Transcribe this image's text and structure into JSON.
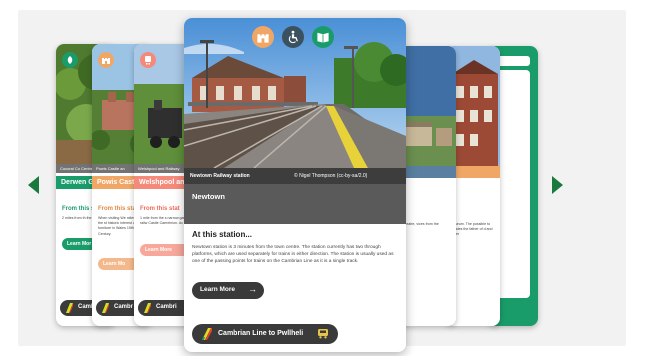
{
  "carousel": {
    "prev_label": "",
    "next_label": ""
  },
  "main_card": {
    "photo_caption": "Newtown Railway station",
    "photo_credit": "© Nigel Thompson (cc-by-sa/2.0)",
    "town": "Newtown",
    "section_title": "At this station...",
    "description": "Newtown station is 3 minutes from the town centre. The station currently has two through platforms, which are used separately for trains in either direction. The station is usually used as one of the passing points for trains on the Cambrian Line as it is a single track.",
    "learn_more": "Learn More",
    "line_button": "Cambrian Line to Pwllheli",
    "icons": [
      "castle-icon",
      "accessibility-icon",
      "book-icon"
    ],
    "colors": {
      "castle": "#f0a766",
      "access": "#3c5160",
      "book": "#1a9c6a",
      "band": "#5a5a5a"
    }
  },
  "left_cards": [
    {
      "title": "Derwen Ga",
      "caption": "Cocoral Co Centre",
      "sub": "From this st",
      "body": "2 miles from th the themed ga",
      "learn": "Learn Mor",
      "line": "Camb",
      "color": "#1a9c6a",
      "badge_text": "V",
      "icon": "leaf-icon"
    },
    {
      "title": "Powis Castl",
      "caption": "Powis Castle an",
      "sub": "From this stat",
      "body": "When visiting We miles from the st historic interest a furniture in Wales 19th Century.",
      "learn": "Learn Mo",
      "line": "Cambr",
      "color": "#f0a766",
      "badge_text": "W",
      "icon": "castle-icon"
    },
    {
      "title": "Welshpool an",
      "caption": "Welshpool and Railway",
      "sub": "From this stat",
      "body": "1 mile from the s narrow gauge railw Castle Caereinion. Ac",
      "learn": "Learn More",
      "line": "Cambri",
      "color": "#f58a7a",
      "badge_text": "Railw",
      "icon": "train-icon"
    }
  ],
  "right_cards": [
    {
      "body": "Theatre, vices from the",
      "color": "#5a7fa0"
    },
    {
      "body": "Museum. The possible to ncludes the father of d and better",
      "color": "#f0a766"
    }
  ]
}
